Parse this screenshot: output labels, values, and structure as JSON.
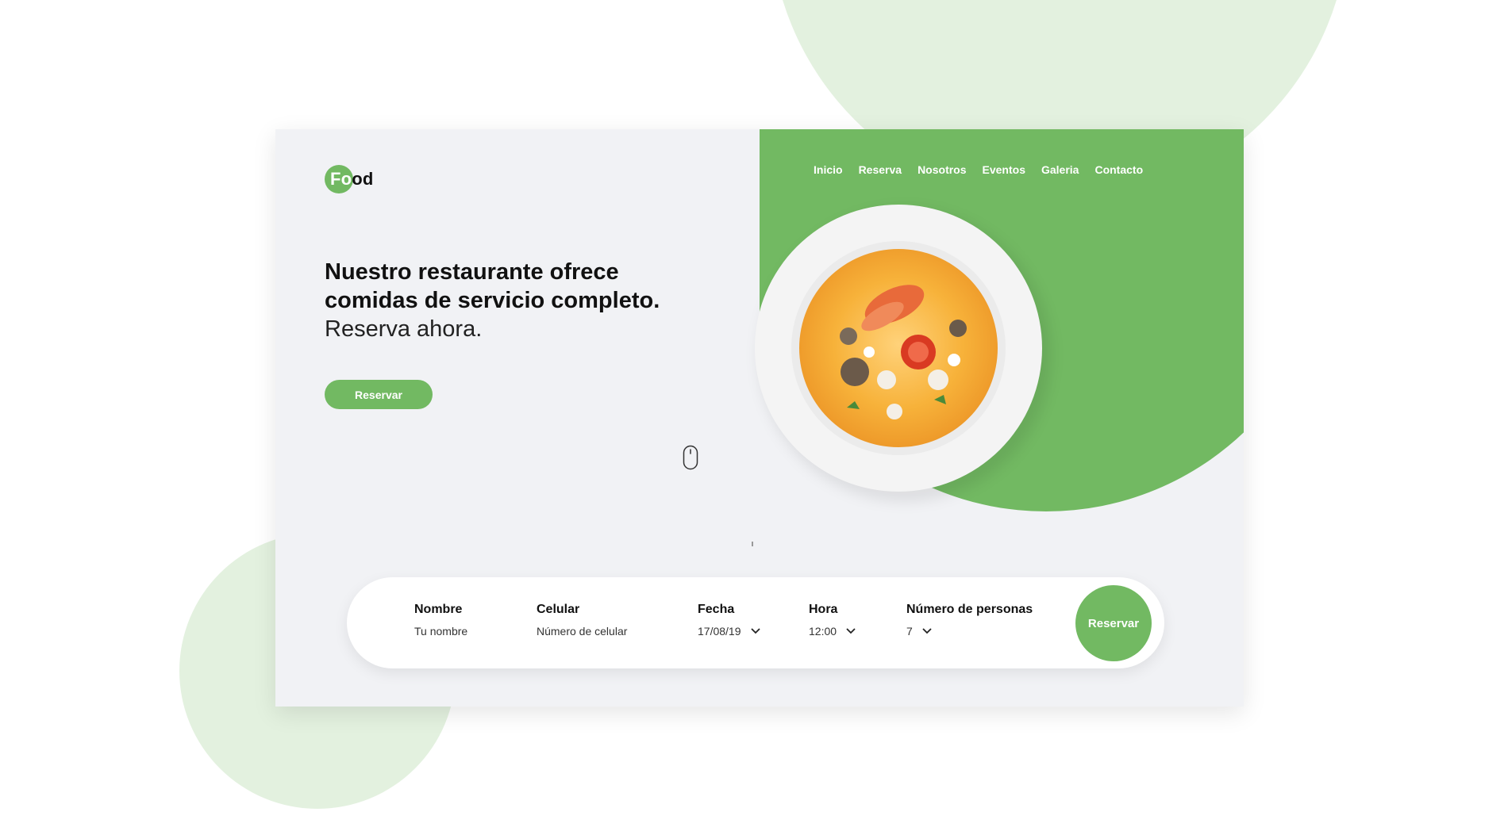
{
  "brand": {
    "logo_text_highlight": "Fo",
    "logo_text_rest": "od",
    "accent_color": "#72b962"
  },
  "nav": {
    "items": [
      {
        "label": "Inicio"
      },
      {
        "label": "Reserva"
      },
      {
        "label": "Nosotros"
      },
      {
        "label": "Eventos"
      },
      {
        "label": "Galeria"
      },
      {
        "label": "Contacto"
      }
    ]
  },
  "hero": {
    "headline_line1": "Nuestro restaurante ofrece",
    "headline_line2": "comidas de servicio completo.",
    "subline": "Reserva ahora.",
    "cta_label": "Reservar",
    "image_icon": "soup-plate-image",
    "scroll_icon": "mouse-scroll-icon"
  },
  "booking": {
    "name": {
      "label": "Nombre",
      "placeholder": "Tu nombre"
    },
    "phone": {
      "label": "Celular",
      "placeholder": "Número de celular"
    },
    "date": {
      "label": "Fecha",
      "value": "17/08/19"
    },
    "time": {
      "label": "Hora",
      "value": "12:00"
    },
    "people": {
      "label": "Número de personas",
      "value": "7"
    },
    "submit_label": "Reservar"
  }
}
